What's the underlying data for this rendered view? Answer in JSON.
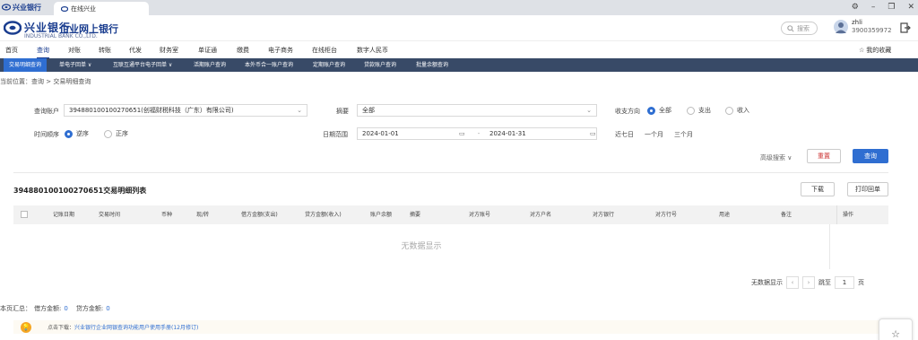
{
  "browser": {
    "bank_tab_logo": "兴业银行",
    "tab_title": "在线兴业",
    "window_controls": [
      "⚙",
      "–",
      "❐",
      "✕"
    ]
  },
  "header": {
    "brand": "兴业银行",
    "brand_en": "INDUSTRIAL BANK CO.,LTD.",
    "product": "企业网上银行",
    "search_placeholder": "搜索",
    "user_name": "zhli",
    "user_account": "3900359972",
    "icons": [
      "search-icon",
      "avatar",
      "logout-icon",
      "star-icon"
    ]
  },
  "nav": {
    "items": [
      "首页",
      "查询",
      "对账",
      "转账",
      "代发",
      "财务室",
      "单证通",
      "缴费",
      "电子商务",
      "在线柜台",
      "数字人民币"
    ],
    "active": "查询",
    "favorites": "我的收藏"
  },
  "subnav": {
    "items": [
      "交易明细查询",
      "单电子回单 ∨",
      "互联互通平台电子回单 ∨",
      "活期账户查询",
      "本外币合一账户查询",
      "定期账户查询",
      "贷款账户查询",
      "批量余额查询"
    ],
    "active": "交易明细查询"
  },
  "breadcrumb": "当前位置：查询 > 交易明细查询",
  "form": {
    "account_label": "查询账户",
    "account_value": "394880100100270651(创福财税科技（广东）有限公司)",
    "summary_label": "摘要",
    "summary_value": "全部",
    "direction_label": "收支方向",
    "direction_options": [
      "全部",
      "支出",
      "收入"
    ],
    "order_label": "时间顺序",
    "order_options": [
      "逆序",
      "正序"
    ],
    "range_label": "日期范围",
    "date_from": "2024-01-01",
    "date_sep": "-",
    "date_to": "2024-01-31",
    "quick_ranges": [
      "近七日",
      "一个月",
      "三个月"
    ],
    "advanced": "高级搜索 ∨",
    "reset": "重置",
    "query": "查询"
  },
  "table": {
    "title": "394880100100270651交易明细列表",
    "download": "下载",
    "print": "打印回单",
    "columns": [
      "记账日期",
      "交易时间",
      "币种",
      "现/转",
      "借方金额(支出)",
      "贷方金额(收入)",
      "账户余额",
      "摘要",
      "对方账号",
      "对方户名",
      "对方银行",
      "对方行号",
      "用途",
      "备注",
      "操作"
    ],
    "empty_text": "无数据显示",
    "pager_status": "无数据显示",
    "jump_label": "跳至",
    "page_value": "1",
    "page_unit": "页"
  },
  "summary": {
    "label": "本页汇总：",
    "debit_label": "借方金额:",
    "debit_value": "0",
    "credit_label": "贷方金额:",
    "credit_value": "0"
  },
  "notice": {
    "prefix": "点击下载：",
    "link": "兴业银行企业网银查询功能用户使用手册(12月修订)"
  },
  "colors": {
    "brand": "#1a3d8f",
    "accent": "#2f6ed1",
    "subnav_bg": "#384a67"
  }
}
